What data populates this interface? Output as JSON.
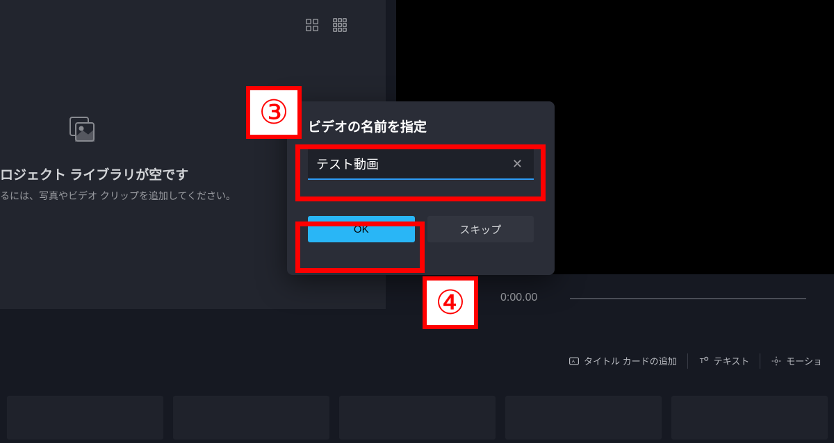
{
  "library": {
    "title": "ロジェクト ライブラリが空です",
    "subtitle": "るには、写真やビデオ クリップを追加してください。"
  },
  "dialog": {
    "title": "ビデオの名前を指定",
    "input_value": "テスト動画",
    "clear_label": "✕",
    "ok_label": "OK",
    "skip_label": "スキップ"
  },
  "preview": {
    "timestamp": "0:00.00"
  },
  "toolbar": {
    "title_card": "タイトル カードの追加",
    "text": "テキスト",
    "motion": "モーショ"
  },
  "annotations": {
    "step3": "③",
    "step4": "④"
  }
}
